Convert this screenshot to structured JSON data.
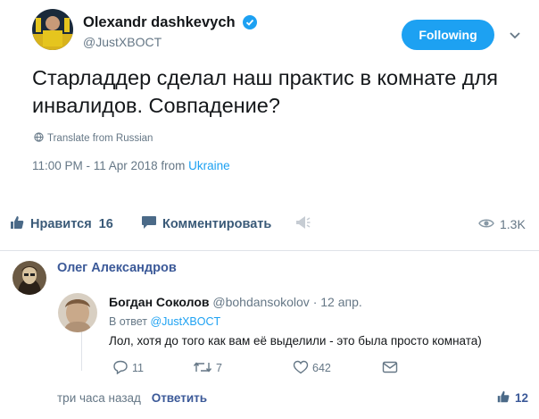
{
  "tweet": {
    "author_name": "Olexandr dashkevych",
    "author_handle": "@JustXBOCT",
    "follow_label": "Following",
    "text": "Старладдер сделал наш практис в комнате для инвалидов. Совпадение?",
    "translate_label": "Translate from Russian",
    "time": "11:00 PM - 11 Apr 2018 from ",
    "place": "Ukraine",
    "icons": [
      "verified-icon",
      "caret-down-icon",
      "globe-icon"
    ]
  },
  "actions": {
    "like_label": "Нравится",
    "like_count": "16",
    "comment_label": "Комментировать",
    "views": "1.3K",
    "icons": [
      "thumbs-up-icon",
      "comment-icon",
      "share-icon",
      "eye-icon"
    ]
  },
  "comment": {
    "author_name": "Олег Александров",
    "time": "три часа назад",
    "reply_label": "Ответить",
    "likes": "12",
    "quoted": {
      "author_name": "Богдан Соколов",
      "author_handle": "@bohdansokolov",
      "separator": "·",
      "date": "12 апр.",
      "reply_to_prefix": "В ответ ",
      "reply_to_handle": "@JustXBOCT",
      "text": "Лол, хотя до того как вам её выделили - это была просто комната)",
      "replies": "11",
      "retweets": "7",
      "likes": "642",
      "icons": [
        "reply-icon",
        "retweet-icon",
        "heart-icon",
        "dm-icon"
      ]
    }
  },
  "colors": {
    "accent": "#1da1f2",
    "facebook_blue": "#3b5998",
    "muted": "#657786"
  }
}
